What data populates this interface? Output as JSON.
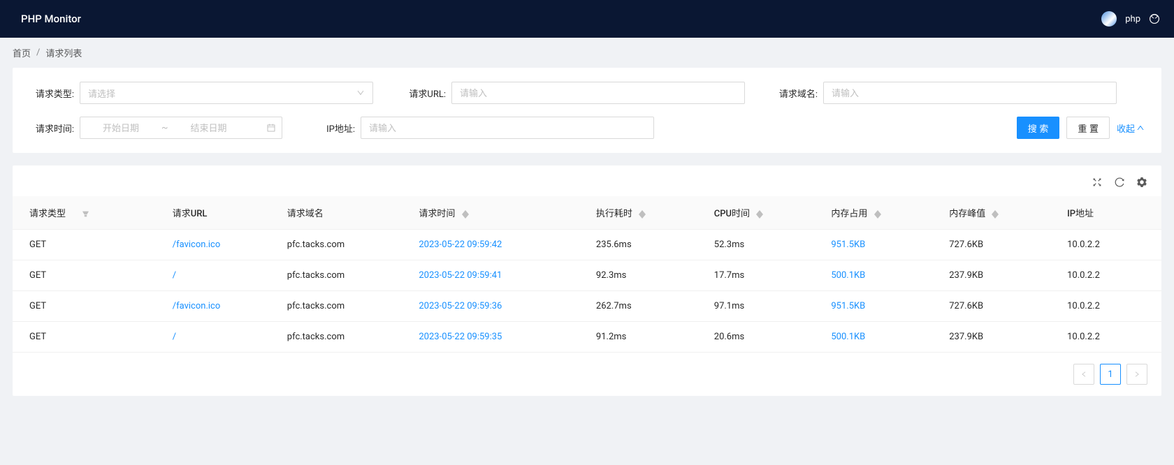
{
  "header": {
    "title": "PHP Monitor",
    "username": "php"
  },
  "breadcrumb": {
    "home": "首页",
    "current": "请求列表"
  },
  "filters": {
    "request_type": {
      "label": "请求类型:",
      "placeholder": "请选择"
    },
    "request_url": {
      "label": "请求URL:",
      "placeholder": "请输入"
    },
    "request_domain": {
      "label": "请求域名:",
      "placeholder": "请输入"
    },
    "request_time": {
      "label": "请求时间:",
      "start_placeholder": "开始日期",
      "end_placeholder": "结束日期"
    },
    "ip": {
      "label": "IP地址:",
      "placeholder": "请输入"
    },
    "search_btn": "搜 索",
    "reset_btn": "重 置",
    "collapse_btn": "收起"
  },
  "table": {
    "columns": {
      "request_type": "请求类型",
      "request_url": "请求URL",
      "request_domain": "请求域名",
      "request_time": "请求时间",
      "exec_time": "执行耗时",
      "cpu_time": "CPU时间",
      "mem_usage": "内存占用",
      "mem_peak": "内存峰值",
      "ip": "IP地址"
    },
    "rows": [
      {
        "type": "GET",
        "url": "/favicon.ico",
        "domain": "pfc.tacks.com",
        "time": "2023-05-22 09:59:42",
        "exec": "235.6ms",
        "cpu": "52.3ms",
        "mem": "951.5KB",
        "peak": "727.6KB",
        "ip": "10.0.2.2"
      },
      {
        "type": "GET",
        "url": "/",
        "domain": "pfc.tacks.com",
        "time": "2023-05-22 09:59:41",
        "exec": "92.3ms",
        "cpu": "17.7ms",
        "mem": "500.1KB",
        "peak": "237.9KB",
        "ip": "10.0.2.2"
      },
      {
        "type": "GET",
        "url": "/favicon.ico",
        "domain": "pfc.tacks.com",
        "time": "2023-05-22 09:59:36",
        "exec": "262.7ms",
        "cpu": "97.1ms",
        "mem": "951.5KB",
        "peak": "727.6KB",
        "ip": "10.0.2.2"
      },
      {
        "type": "GET",
        "url": "/",
        "domain": "pfc.tacks.com",
        "time": "2023-05-22 09:59:35",
        "exec": "91.2ms",
        "cpu": "20.6ms",
        "mem": "500.1KB",
        "peak": "237.9KB",
        "ip": "10.0.2.2"
      }
    ]
  },
  "pagination": {
    "current": "1"
  }
}
